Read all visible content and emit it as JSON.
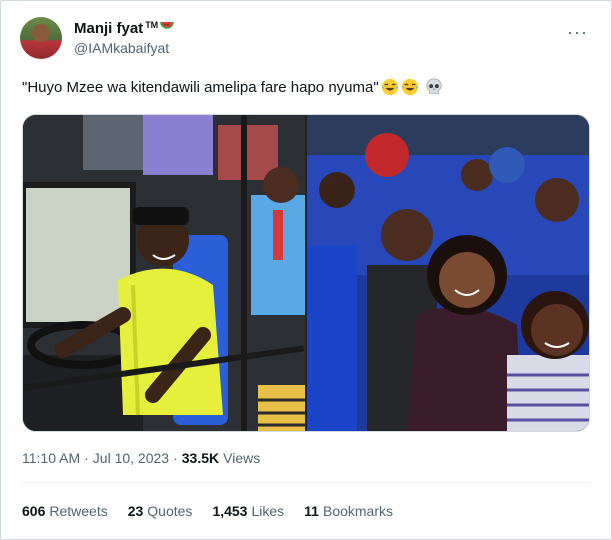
{
  "author": {
    "display_name": "Manji fyat",
    "tm": "TM",
    "handle": "@IAMkabaifyat"
  },
  "tweet": {
    "text": "\"Huyo Mzee wa kitendawili amelipa fare hapo nyuma\"",
    "emojis": [
      "face-with-tears-of-joy-icon",
      "face-with-tears-of-joy-icon",
      "skull-icon"
    ]
  },
  "meta": {
    "time": "11:10 AM",
    "sep1": "·",
    "date": "Jul 10, 2023",
    "sep2": "·",
    "views_count": "33.5K",
    "views_label": "Views"
  },
  "stats": [
    {
      "num": "606",
      "label": "Retweets"
    },
    {
      "num": "23",
      "label": "Quotes"
    },
    {
      "num": "1,453",
      "label": "Likes"
    },
    {
      "num": "11",
      "label": "Bookmarks"
    }
  ],
  "more_glyph": "···"
}
